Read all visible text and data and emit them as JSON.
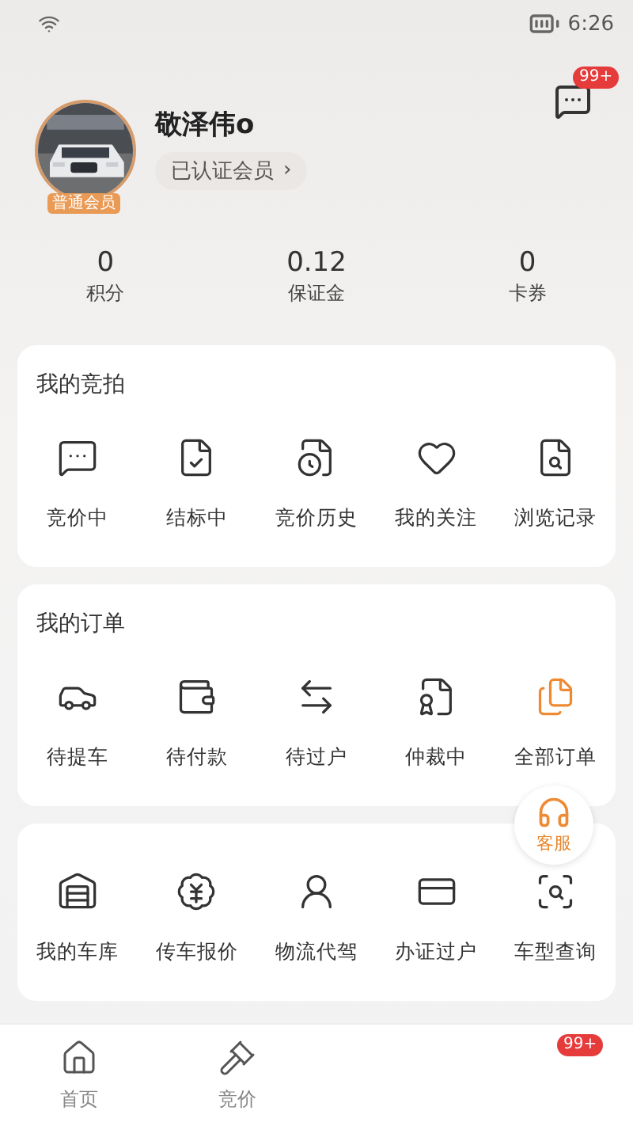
{
  "status_bar": {
    "time": "6:26"
  },
  "profile": {
    "name": "敬泽伟o",
    "avatar_badge": "普通会员",
    "member_status": "已认证会员",
    "member_chevron": "›",
    "message_badge": "99+"
  },
  "stats": [
    {
      "value": "0",
      "label": "积分"
    },
    {
      "value": "0.12",
      "label": "保证金"
    },
    {
      "value": "0",
      "label": "卡券"
    }
  ],
  "sections": [
    {
      "title": "我的竞拍",
      "items": [
        "竞价中",
        "结标中",
        "竞价历史",
        "我的关注",
        "浏览记录"
      ]
    },
    {
      "title": "我的订单",
      "items": [
        "待提车",
        "待付款",
        "待过户",
        "仲裁中",
        "全部订单"
      ]
    },
    {
      "items": [
        "我的车库",
        "传车报价",
        "物流代驾",
        "办证过户",
        "车型查询"
      ]
    }
  ],
  "service_button": {
    "label": "客服"
  },
  "bottom_nav": {
    "tabs": [
      {
        "label": "首页"
      },
      {
        "label": "竞价"
      }
    ],
    "badge": "99+"
  }
}
